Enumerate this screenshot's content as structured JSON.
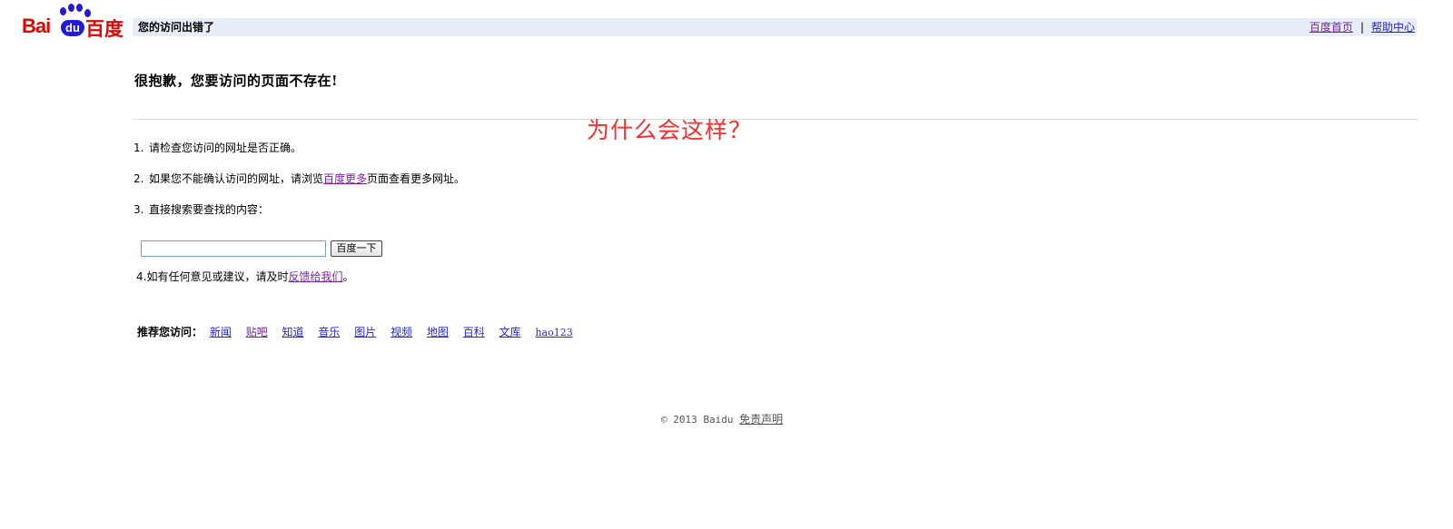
{
  "logo": {
    "text_left": "Bai",
    "text_mid": "du",
    "text_right": "百度"
  },
  "header": {
    "title": "您的访问出错了",
    "links": [
      {
        "label": "百度首页"
      },
      {
        "label": "帮助中心"
      }
    ],
    "separator": "|"
  },
  "main": {
    "title": "很抱歉，您要访问的页面不存在!",
    "annotation": "为什么会这样？",
    "tips": [
      {
        "num": "1.",
        "text": "请检查您访问的网址是否正确。"
      },
      {
        "num": "2.",
        "before": "如果您不能确认访问的网址，请浏览",
        "link": "百度更多",
        "after": "页面查看更多网址。"
      },
      {
        "num": "3.",
        "text": "直接搜索要查找的内容："
      },
      {
        "num": "4.",
        "before": "如有任何意见或建议，请及时",
        "link": "反馈给我们",
        "after": "。"
      }
    ],
    "search": {
      "value": "",
      "placeholder": "",
      "button_label": "百度一下"
    },
    "recommend": {
      "label": "推荐您访问：",
      "links": [
        "新闻",
        "贴吧",
        "知道",
        "音乐",
        "图片",
        "视频",
        "地图",
        "百科",
        "文库",
        "hao123"
      ]
    }
  },
  "footer": {
    "copyright": "© 2013 Baidu",
    "disclaimer": "免责声明"
  },
  "colors": {
    "header_bg": "#e6ecf8",
    "logo_red": "#e10601",
    "logo_blue": "#2319dc",
    "annotation_red": "#ff2a2a",
    "visited_link": "#7b1fa2",
    "link": "#2626d8"
  }
}
